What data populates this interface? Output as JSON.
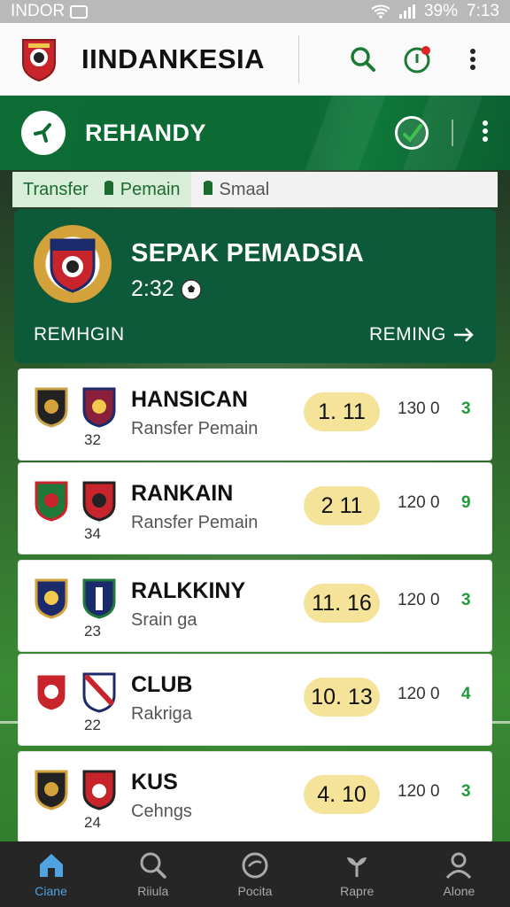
{
  "status": {
    "left_text": "INDOR",
    "battery": "39%",
    "time": "7:13"
  },
  "app": {
    "title": "IINDANKESIA"
  },
  "banner": {
    "title": "REHANDY"
  },
  "tabs": [
    {
      "label": "Transfer",
      "active": true
    },
    {
      "label": "Pemain",
      "active": true,
      "icon": "shirt-icon"
    },
    {
      "label": "Smaal",
      "active": false,
      "icon": "shirt-icon"
    }
  ],
  "feature": {
    "title": "SEPAK PEMADSIA",
    "score": "2:32",
    "left_label": "REMHGIN",
    "right_label": "REMING"
  },
  "rows": [
    {
      "name": "HANSICAN",
      "sub": "Ransfer Pemain",
      "num": "32",
      "pill": "1.  11",
      "stat": "130  0",
      "stat_g": "3"
    },
    {
      "name": "RANKAIN",
      "sub": "Ransfer Pemain",
      "num": "34",
      "pill": "2  11",
      "stat": "120  0",
      "stat_g": "9"
    },
    {
      "name": "RALKKINY",
      "sub": "Srain ga",
      "num": "23",
      "pill": "11.  16",
      "stat": "120  0",
      "stat_g": "3"
    },
    {
      "name": "CLUB",
      "sub": "Rakriga",
      "num": "22",
      "pill": "10.  13",
      "stat": "120  0",
      "stat_g": "4"
    },
    {
      "name": "KUS",
      "sub": "Cehngs",
      "num": "24",
      "pill": "4.  10",
      "stat": "120  0",
      "stat_g": "3"
    }
  ],
  "nav": [
    {
      "label": "Ciane",
      "icon": "home-icon",
      "active": true
    },
    {
      "label": "Riiula",
      "icon": "search-icon",
      "active": false
    },
    {
      "label": "Pocita",
      "icon": "clock-icon",
      "active": false
    },
    {
      "label": "Rapre",
      "icon": "plant-icon",
      "active": false
    },
    {
      "label": "Alone",
      "icon": "user-icon",
      "active": false
    }
  ],
  "colors": {
    "green": "#0d6b34",
    "accent": "#4fa3e0",
    "pill": "#f6e39a"
  }
}
